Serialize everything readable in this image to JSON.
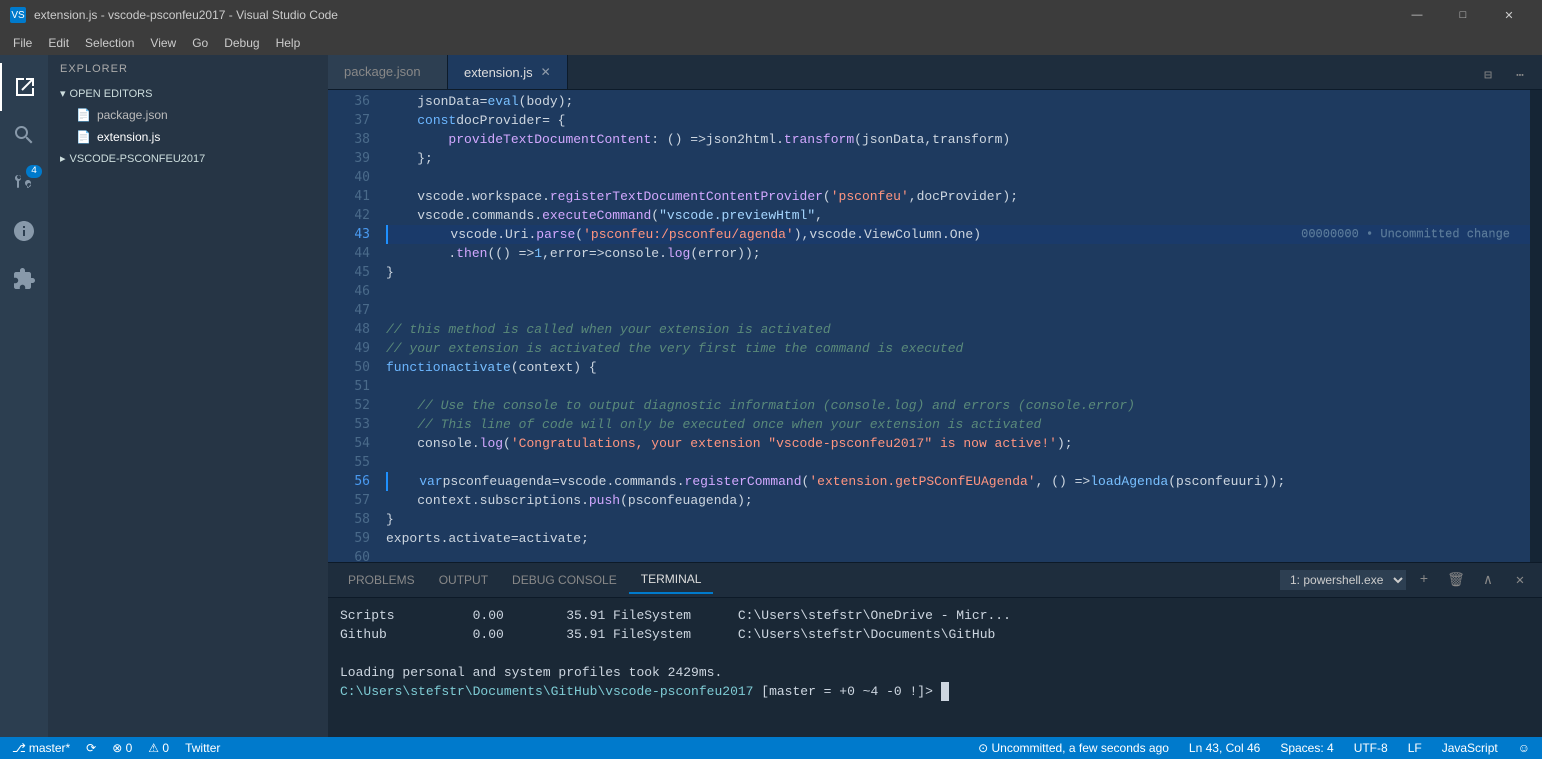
{
  "window": {
    "title": "extension.js - vscode-psconfeu2017 - Visual Studio Code",
    "icon": "VS"
  },
  "menu": {
    "items": [
      "File",
      "Edit",
      "Selection",
      "View",
      "Go",
      "Debug",
      "Help"
    ]
  },
  "activity_bar": {
    "icons": [
      {
        "name": "explorer",
        "symbol": "⎘",
        "active": true
      },
      {
        "name": "search",
        "symbol": "🔍"
      },
      {
        "name": "source-control",
        "symbol": "⎇",
        "badge": "4"
      },
      {
        "name": "debug",
        "symbol": "🐛"
      },
      {
        "name": "extensions",
        "symbol": "⊞"
      }
    ]
  },
  "sidebar": {
    "header": "EXPLORER",
    "sections": [
      {
        "title": "OPEN EDITORS",
        "items": [
          "package.json",
          "extension.js"
        ]
      },
      {
        "title": "VSCODE-PSCONFEU2017",
        "items": []
      }
    ]
  },
  "tabs": [
    {
      "label": "package.json",
      "active": false
    },
    {
      "label": "extension.js",
      "active": true,
      "closable": true
    }
  ],
  "code": {
    "lines": [
      {
        "num": 36,
        "content": "    jsonData = eval(body);",
        "changed": false,
        "highlighted": false
      },
      {
        "num": 37,
        "content": "    const docProvider = {",
        "changed": false,
        "highlighted": false
      },
      {
        "num": 38,
        "content": "        provideTextDocumentContent: () => json2html.transform(jsonData, transform)",
        "changed": false,
        "highlighted": false
      },
      {
        "num": 39,
        "content": "    };",
        "changed": false,
        "highlighted": false
      },
      {
        "num": 40,
        "content": "",
        "changed": false,
        "highlighted": false
      },
      {
        "num": 41,
        "content": "    vscode.workspace.registerTextDocumentContentProvider('psconfeu', docProvider);",
        "changed": false,
        "highlighted": false
      },
      {
        "num": 42,
        "content": "    vscode.commands.executeCommand(\"vscode.previewHtml\",",
        "changed": false,
        "highlighted": false
      },
      {
        "num": 43,
        "content": "        vscode.Uri.parse('psconfeu:/psconfeu/agenda'), vscode.ViewColumn.One)",
        "changed": true,
        "highlighted": true,
        "annotation": "00000000 • Uncommitted change"
      },
      {
        "num": 44,
        "content": "        .then(() => 1, error => console.log(error));",
        "changed": false,
        "highlighted": false
      },
      {
        "num": 45,
        "content": "}",
        "changed": false,
        "highlighted": false
      },
      {
        "num": 46,
        "content": "",
        "changed": false,
        "highlighted": false
      },
      {
        "num": 47,
        "content": "",
        "changed": false,
        "highlighted": false
      },
      {
        "num": 48,
        "content": "// this method is called when your extension is activated",
        "changed": false,
        "highlighted": false
      },
      {
        "num": 49,
        "content": "// your extension is activated the very first time the command is executed",
        "changed": false,
        "highlighted": false
      },
      {
        "num": 50,
        "content": "function activate(context) {",
        "changed": false,
        "highlighted": false
      },
      {
        "num": 51,
        "content": "",
        "changed": false,
        "highlighted": false
      },
      {
        "num": 52,
        "content": "    // Use the console to output diagnostic information (console.log) and errors (console.error)",
        "changed": false,
        "highlighted": false
      },
      {
        "num": 53,
        "content": "    // This line of code will only be executed once when your extension is activated",
        "changed": false,
        "highlighted": false
      },
      {
        "num": 54,
        "content": "    console.log('Congratulations, your extension \"vscode-psconfeu2017\" is now active!');",
        "changed": false,
        "highlighted": false
      },
      {
        "num": 55,
        "content": "",
        "changed": false,
        "highlighted": false
      },
      {
        "num": 56,
        "content": "    var psconfeuagenda = vscode.commands.registerCommand('extension.getPSConfEUAgenda', () => loadAgenda(psconfeuuri));",
        "changed": true,
        "highlighted": false
      },
      {
        "num": 57,
        "content": "    context.subscriptions.push(psconfeuagenda);",
        "changed": false,
        "highlighted": false
      },
      {
        "num": 58,
        "content": "}",
        "changed": false,
        "highlighted": false
      },
      {
        "num": 59,
        "content": "exports.activate = activate;",
        "changed": false,
        "highlighted": false
      },
      {
        "num": 60,
        "content": "",
        "changed": false,
        "highlighted": false
      }
    ]
  },
  "panel": {
    "tabs": [
      "PROBLEMS",
      "OUTPUT",
      "DEBUG CONSOLE",
      "TERMINAL"
    ],
    "active_tab": "TERMINAL",
    "terminal": {
      "shell": "1: powershell.exe",
      "lines": [
        "Scripts          0.00        35.91 FileSystem      C:\\Users\\stefstr\\OneDrive - Micr...",
        "Github           0.00        35.91 FileSystem      C:\\Users\\stefstr\\Documents\\GitHub",
        "",
        "Loading personal and system profiles took 2429ms.",
        "C:\\Users\\stefstr\\Documents\\GitHub\\vscode-psconfeu2017 [master = +0 ~4 -0 !]> "
      ]
    }
  },
  "status_bar": {
    "branch": "master*",
    "sync": "⟳",
    "errors": "⊗ 0",
    "warnings": "⚠ 0",
    "twitter": "Twitter",
    "position": "Ln 43, Col 46",
    "spaces": "Spaces: 4",
    "encoding": "UTF-8",
    "line_ending": "LF",
    "language": "JavaScript",
    "uncommitted": "⊙ Uncommitted, a few seconds ago",
    "face": "☺"
  }
}
